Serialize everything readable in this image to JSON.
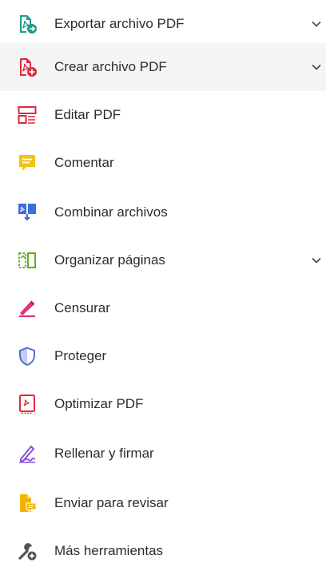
{
  "tools": [
    {
      "label": "Exportar archivo PDF",
      "icon": "export-pdf-icon",
      "expandable": true
    },
    {
      "label": "Crear archivo PDF",
      "icon": "create-pdf-icon",
      "expandable": true
    },
    {
      "label": "Editar PDF",
      "icon": "edit-pdf-icon",
      "expandable": false
    },
    {
      "label": "Comentar",
      "icon": "comment-icon",
      "expandable": false
    },
    {
      "label": "Combinar archivos",
      "icon": "combine-files-icon",
      "expandable": false
    },
    {
      "label": "Organizar páginas",
      "icon": "organize-pages-icon",
      "expandable": true
    },
    {
      "label": "Censurar",
      "icon": "redact-icon",
      "expandable": false
    },
    {
      "label": "Proteger",
      "icon": "protect-shield-icon",
      "expandable": false
    },
    {
      "label": "Optimizar PDF",
      "icon": "optimize-pdf-icon",
      "expandable": false
    },
    {
      "label": "Rellenar y firmar",
      "icon": "fill-sign-icon",
      "expandable": false
    },
    {
      "label": "Enviar para revisar",
      "icon": "send-review-icon",
      "expandable": false
    },
    {
      "label": "Más herramientas",
      "icon": "more-tools-icon",
      "expandable": false
    }
  ],
  "colors": {
    "export": "#1f9c8a",
    "pdf_red": "#e0293e",
    "comment": "#f2c318",
    "combine": "#3a6fd8",
    "organize": "#6aaa1e",
    "redact": "#e0337c",
    "protect": "#4d6fd0",
    "fill_sign": "#8a4fd8",
    "send_review": "#f0b400",
    "more_tools": "#555555",
    "shaded_row": "#f5f5f5"
  }
}
